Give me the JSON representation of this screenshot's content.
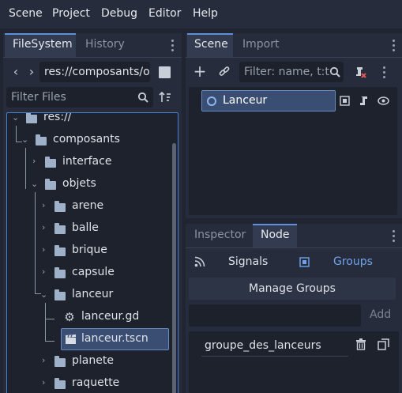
{
  "menubar": {
    "items": [
      "Scene",
      "Project",
      "Debug",
      "Editor",
      "Help"
    ]
  },
  "filesystem": {
    "tabs": [
      "FileSystem",
      "History"
    ],
    "path": "res://composants/o",
    "filter_placeholder": "Filter Files",
    "tree": [
      {
        "label": "res://",
        "type": "folder",
        "expanded": true
      },
      {
        "label": "composants",
        "type": "folder",
        "expanded": true
      },
      {
        "label": "interface",
        "type": "folder",
        "expanded": false
      },
      {
        "label": "objets",
        "type": "folder",
        "expanded": true
      },
      {
        "label": "arene",
        "type": "folder",
        "expanded": false
      },
      {
        "label": "balle",
        "type": "folder",
        "expanded": false
      },
      {
        "label": "brique",
        "type": "folder",
        "expanded": false
      },
      {
        "label": "capsule",
        "type": "folder",
        "expanded": false
      },
      {
        "label": "lanceur",
        "type": "folder",
        "expanded": true
      },
      {
        "label": "lanceur.gd",
        "type": "script"
      },
      {
        "label": "lanceur.tscn",
        "type": "scene",
        "selected": true
      },
      {
        "label": "planete",
        "type": "folder",
        "expanded": false
      },
      {
        "label": "raquette",
        "type": "folder",
        "expanded": false
      }
    ]
  },
  "scene_dock": {
    "tabs": [
      "Scene",
      "Import"
    ],
    "filter_placeholder": "Filter: name, t:t",
    "root_node": "Lanceur"
  },
  "node_dock": {
    "tabs": [
      "Inspector",
      "Node"
    ],
    "signals_label": "Signals",
    "groups_label": "Groups",
    "manage_groups_label": "Manage Groups",
    "add_label": "Add",
    "groups": [
      "groupe_des_lanceurs"
    ]
  },
  "colors": {
    "accent": "#5e8fd8",
    "background": "#202531",
    "panel": "#262c3b"
  }
}
